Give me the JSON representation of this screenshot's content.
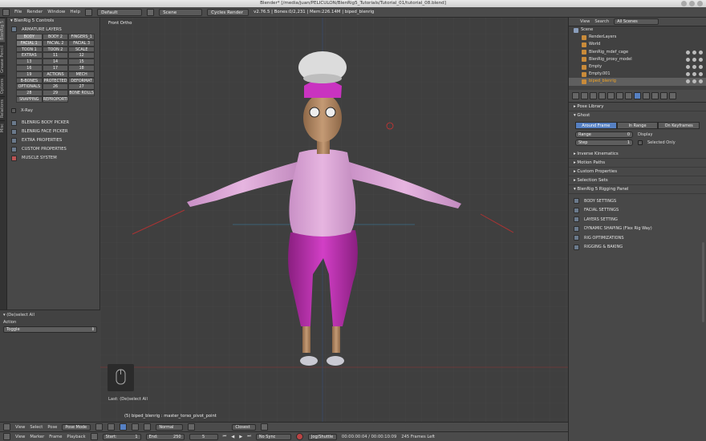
{
  "title": "Blender* [/media/juan/PELICULON/BlenRig5_Tutorials/Tutorial_01/tutorial_08.blend]",
  "topbar": {
    "menus": [
      "File",
      "Render",
      "Window",
      "Help"
    ],
    "layout": "Default",
    "scene": "Scene",
    "engine": "Cycles Render",
    "info": "v2.76.5 | Bones:0/2,231 | Mem:226.14M | biped_blenrig"
  },
  "tool_tabs": [
    "BlenRig 5",
    "Grease Pencil",
    "Options",
    "Relations",
    "Misc"
  ],
  "leftpanel": {
    "header": "BlenRig 5 Controls",
    "armature_layers": "ARMATURE LAYERS",
    "layers": [
      "BODY",
      "BODY 2",
      "FINGERS_1",
      "FACIAL 1",
      "FACIAL 2",
      "FACIAL 3",
      "TOON 1",
      "TOON 2",
      "SCALE",
      "EXTRAS",
      "11",
      "12",
      "13",
      "14",
      "15",
      "16",
      "17",
      "18",
      "19",
      "ACTIONS",
      "MECH",
      "B-BONES",
      "PROTECTED",
      "DEFORMAT",
      "OPTIONALS",
      "26",
      "27",
      "28",
      "29",
      "BONE ROLLS",
      "SNAPPING",
      "REPROPORTI"
    ],
    "xray": "X-Ray",
    "tools": [
      "BLENRIG BODY PICKER",
      "BLENRIG FACE PICKER",
      "EXTRA PROPERTIES",
      "CUSTOM PROPERTIES",
      "MUSCLE SYSTEM"
    ]
  },
  "operator": {
    "title": "(De)select All",
    "action_label": "Action",
    "action_value": "Toggle"
  },
  "viewport": {
    "label": "Front Ortho",
    "last": "Last: (De)select All",
    "object": "(5) biped_blenrig : master_torso_pivot_point"
  },
  "view3d_header": {
    "items": [
      "View",
      "Select",
      "Pose"
    ],
    "mode": "Pose Mode",
    "pivot": "Normal",
    "snap": "Closest"
  },
  "timeline_header": {
    "items": [
      "View",
      "Marker",
      "Frame",
      "Playback"
    ],
    "start_label": "Start:",
    "start": "1",
    "end_label": "End:",
    "end": "250",
    "current": "5",
    "sync": "No Sync",
    "keying": "Jog/Shuttle",
    "time": "00:00:00:04 / 00:00:10:09",
    "frames": "245 Frames Left"
  },
  "outliner": {
    "menus": [
      "View",
      "Search"
    ],
    "filter": "All Scenes",
    "rows": [
      {
        "label": "Scene",
        "indent": 0
      },
      {
        "label": "RenderLayers",
        "indent": 1
      },
      {
        "label": "World",
        "indent": 1
      },
      {
        "label": "BlenRig_mdef_cage",
        "indent": 1
      },
      {
        "label": "BlenRig_proxy_model",
        "indent": 1
      },
      {
        "label": "Empty",
        "indent": 1
      },
      {
        "label": "Empty.001",
        "indent": 1
      },
      {
        "label": "biped_blenrig",
        "indent": 1,
        "selected": true
      }
    ]
  },
  "properties": {
    "sections_top": [
      "Pose Library",
      "Ghost"
    ],
    "ghost_modes": [
      "Around Frame",
      "In Range",
      "On Keyframes"
    ],
    "range_label": "Range",
    "range": "0",
    "step_label": "Step",
    "step": "1",
    "display_label": "Display",
    "selected_only": "Selected Only",
    "sections_mid": [
      "Inverse Kinematics",
      "Motion Paths",
      "Custom Properties",
      "Selection Sets",
      "BlenRig 5 Rigging Panel"
    ],
    "rig_items": [
      "BODY SETTINGS",
      "FACIAL SETTINGS",
      "LAYERS SETTING",
      "DYNAMIC SHAPING (Flex Rig Way)",
      "RIG OPTIMIZATIONS",
      "RIGGING & BAKING"
    ]
  },
  "colors": {
    "accent": "#5680c2",
    "selected": "#f5a623",
    "character_pink": "#c22fb7"
  }
}
